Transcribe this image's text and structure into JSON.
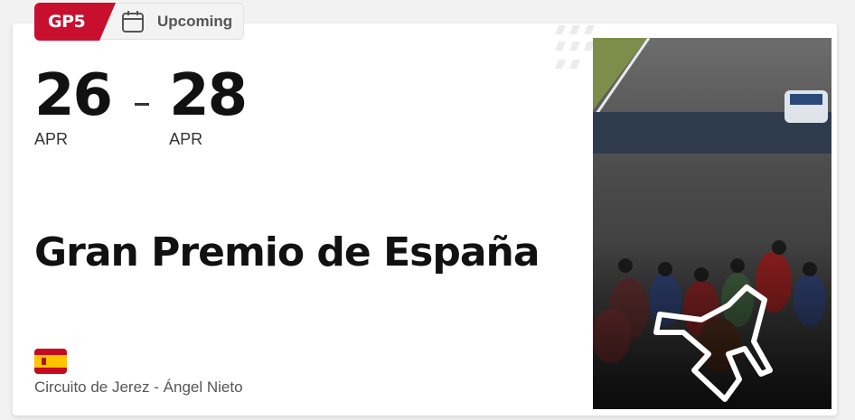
{
  "event": {
    "round_label": "GP5",
    "status_label": "Upcoming",
    "start_day": "26",
    "start_month": "APR",
    "end_day": "28",
    "end_month": "APR",
    "name": "Gran Premio de España",
    "circuit": "Circuito de Jerez - Ángel Nieto",
    "country_flag": "spain-flag"
  },
  "colors": {
    "brand_red": "#c8102e",
    "text_dark": "#111111",
    "text_muted": "#555555"
  }
}
